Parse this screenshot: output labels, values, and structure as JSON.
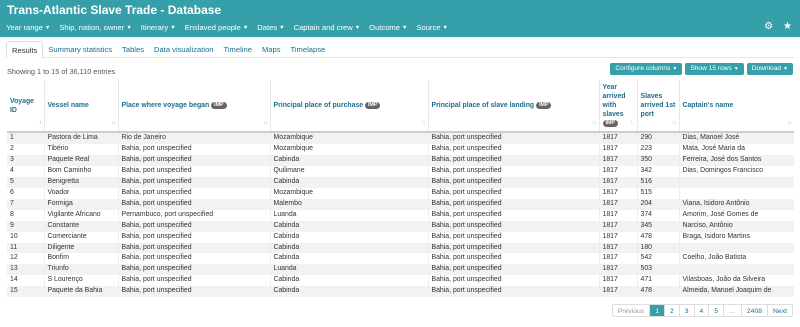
{
  "header": {
    "title": "Trans-Atlantic Slave Trade - Database",
    "menu": [
      "Year range",
      "Ship, nation, owner",
      "Itinerary",
      "Enslaved people",
      "Dates",
      "Captain and crew",
      "Outcome",
      "Source"
    ],
    "icons": [
      "gear-icon",
      "star-icon"
    ]
  },
  "tabs": [
    "Results",
    "Summary statistics",
    "Tables",
    "Data visualization",
    "Timeline",
    "Maps",
    "Timelapse"
  ],
  "active_tab": "Results",
  "info": "Showing 1 to 15 of 36,110 entries",
  "controls": {
    "configure": "Configure columns",
    "show": "Show 15 rows",
    "download": "Download"
  },
  "imp_badge": "IMP",
  "columns": [
    {
      "label": "Voyage ID",
      "imp": false
    },
    {
      "label": "Vessel name",
      "imp": false
    },
    {
      "label": "Place where voyage began",
      "imp": true
    },
    {
      "label": "Principal place of purchase",
      "imp": true
    },
    {
      "label": "Principal place of slave landing",
      "imp": true
    },
    {
      "label": "Year arrived with slaves",
      "imp": true
    },
    {
      "label": "Slaves arrived 1st port",
      "imp": false
    },
    {
      "label": "Captain's name",
      "imp": false
    }
  ],
  "rows": [
    [
      "1",
      "Pastora de Lima",
      "Rio de Janeiro",
      "Mozambique",
      "Bahia, port unspecified",
      "1817",
      "290",
      "Dias, Manoel José"
    ],
    [
      "2",
      "Tibério",
      "Bahia, port unspecified",
      "Mozambique",
      "Bahia, port unspecified",
      "1817",
      "223",
      "Mata, José Maria da"
    ],
    [
      "3",
      "Paquete Real",
      "Bahia, port unspecified",
      "Cabinda",
      "Bahia, port unspecified",
      "1817",
      "350",
      "Ferreira, José dos Santos"
    ],
    [
      "4",
      "Bom Caminho",
      "Bahia, port unspecified",
      "Quilimane",
      "Bahia, port unspecified",
      "1817",
      "342",
      "Dias, Domingos Francisco"
    ],
    [
      "5",
      "Benigretta",
      "Bahia, port unspecified",
      "Cabinda",
      "Bahia, port unspecified",
      "1817",
      "516",
      ""
    ],
    [
      "6",
      "Voador",
      "Bahia, port unspecified",
      "Mozambique",
      "Bahia, port unspecified",
      "1817",
      "515",
      ""
    ],
    [
      "7",
      "Formiga",
      "Bahia, port unspecified",
      "Malembo",
      "Bahia, port unspecified",
      "1817",
      "204",
      "Viana, Isidoro Antônio"
    ],
    [
      "8",
      "Vigilante Africano",
      "Pernambuco, port unspecified",
      "Luanda",
      "Bahia, port unspecified",
      "1817",
      "374",
      "Amorim, José Gomes de"
    ],
    [
      "9",
      "Constante",
      "Bahia, port unspecified",
      "Cabinda",
      "Bahia, port unspecified",
      "1817",
      "345",
      "Narciso, Antônio"
    ],
    [
      "10",
      "Comerciante",
      "Bahia, port unspecified",
      "Cabinda",
      "Bahia, port unspecified",
      "1817",
      "478",
      "Braga, Isidoro Martins"
    ],
    [
      "11",
      "Diligente",
      "Bahia, port unspecified",
      "Cabinda",
      "Bahia, port unspecified",
      "1817",
      "180",
      ""
    ],
    [
      "12",
      "Bonfim",
      "Bahia, port unspecified",
      "Cabinda",
      "Bahia, port unspecified",
      "1817",
      "542",
      "Coelho, João Batista"
    ],
    [
      "13",
      "Triunfo",
      "Bahia, port unspecified",
      "Luanda",
      "Bahia, port unspecified",
      "1817",
      "503",
      ""
    ],
    [
      "14",
      "S Lourenço",
      "Bahia, port unspecified",
      "Cabinda",
      "Bahia, port unspecified",
      "1817",
      "471",
      "Vilasboas, João da Silveira"
    ],
    [
      "15",
      "Paquete da Bahia",
      "Bahia, port unspecified",
      "Cabinda",
      "Bahia, port unspecified",
      "1817",
      "478",
      "Almeida, Manoel Joaquim de"
    ]
  ],
  "pagination": {
    "previous": "Previous",
    "pages": [
      "1",
      "2",
      "3",
      "4",
      "5",
      "…",
      "2408"
    ],
    "active": "1",
    "next": "Next"
  }
}
